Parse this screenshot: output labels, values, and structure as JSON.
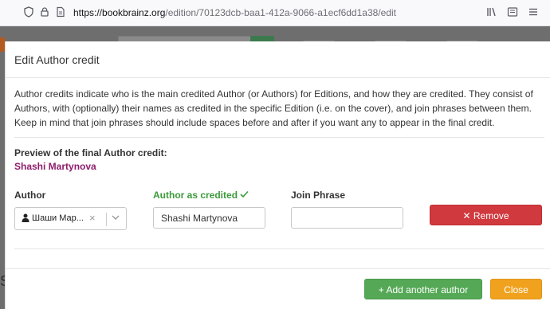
{
  "browser": {
    "url_host": "https://bookbrainz.org",
    "url_path": "/edition/70123dcb-baa1-412a-9066-a1ecf6dd1a38/edit"
  },
  "modal": {
    "title": "Edit Author credit",
    "intro": "Author credits indicate who is the main credited Author (or Authors) for Editions, and how they are credited. They consist of Authors, with (optionally) their names as credited in the specific Edition (i.e. on the cover), and join phrases between them. Keep in mind that join phrases should include spaces before and after if you want any to appear in the final credit.",
    "preview_label": "Preview of the final Author credit:",
    "preview_value": "Shashi Martynova",
    "columns": {
      "author": "Author",
      "author_as_credited": "Author as credited",
      "join_phrase": "Join Phrase"
    },
    "row": {
      "author_value": "Шаши Мар...",
      "credited_value": "Shashi Martynova",
      "join_phrase_value": "",
      "remove_label": "Remove"
    },
    "footer": {
      "add_label": "Add another author",
      "close_label": "Close"
    }
  },
  "backdrop": {
    "partial_letter": "S"
  },
  "colors": {
    "preview": "#8e1d6b",
    "credited_ok": "#3a9a3a",
    "remove": "#d0393e",
    "add": "#55a956",
    "close": "#f0a21f"
  },
  "icons": [
    "shield-icon",
    "lock-icon",
    "page-icon",
    "library-icon",
    "reader-icon",
    "menu-icon",
    "person-icon",
    "clear-icon",
    "chevron-down-icon",
    "check-icon",
    "times-icon",
    "plus-icon"
  ]
}
